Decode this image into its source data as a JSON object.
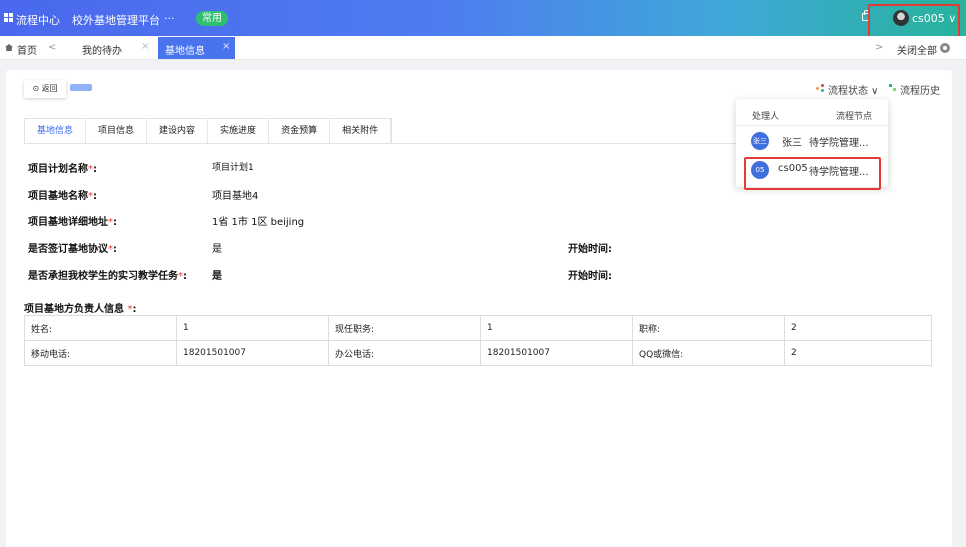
{
  "colors": {
    "header_start": "#4a68ee",
    "header_end": "#27b39b",
    "accent": "#3a6cf0",
    "highlight": "#e53935",
    "required": "#e53935",
    "badge": "#2fbf71"
  },
  "header": {
    "icon": "grid-apps-icon",
    "title": "流程中心",
    "platform": "校外基地管理平台",
    "more": "···",
    "badge": "常用",
    "username": "cs005 ∨"
  },
  "tabs": {
    "home": "首页",
    "prev": "<",
    "next": ">",
    "pending": "我的待办",
    "active": "基地信息",
    "close": "×",
    "close_all": "关闭全部"
  },
  "toolbar": {
    "back": "⊙ 返回",
    "flow_state": "流程状态 ∨",
    "flow_history": "流程历史"
  },
  "sub_tabs": [
    "基地信息",
    "项目信息",
    "建设内容",
    "实施进度",
    "资金预算",
    "相关附件"
  ],
  "form": {
    "plan_name_label": "项目计划名称",
    "plan_name_req": "*",
    "plan_name_colon": ":",
    "plan_name_value": "项目计划1",
    "base_name_label": "项目基地名称",
    "base_name_req": "*",
    "base_name_colon": ":",
    "base_name_value": "项目基地4",
    "address_label": "项目基地详细地址",
    "address_req": "*",
    "address_colon": ":",
    "address_value": "1省 1市 1区 beijing",
    "agreement_label": "是否签订基地协议",
    "agreement_req": "*",
    "agreement_colon": ":",
    "agreement_value": "是",
    "start_time_label_1": "开始时间:",
    "internship_label": "是否承担我校学生的实习教学任务",
    "internship_req": "*",
    "internship_colon": ":",
    "internship_value": "是",
    "start_time_label_2": "开始时间:",
    "contact_title": "项目基地方负责人信息",
    "contact_req": "*",
    "contact_colon": ":"
  },
  "contact_table": [
    [
      "姓名:",
      "1",
      "现任职务:",
      "1",
      "职称:",
      "2"
    ],
    [
      "移动电话:",
      "18201501007",
      "办公电话:",
      "18201501007",
      "QQ或微信:",
      "2"
    ]
  ],
  "popover": {
    "col_handler": "处理人",
    "col_node": "流程节点",
    "rows": [
      {
        "avatar": "张三",
        "name": "张三",
        "node": "待学院管理..."
      },
      {
        "avatar": "05",
        "name": "cs005",
        "node": "待学院管理..."
      }
    ]
  }
}
